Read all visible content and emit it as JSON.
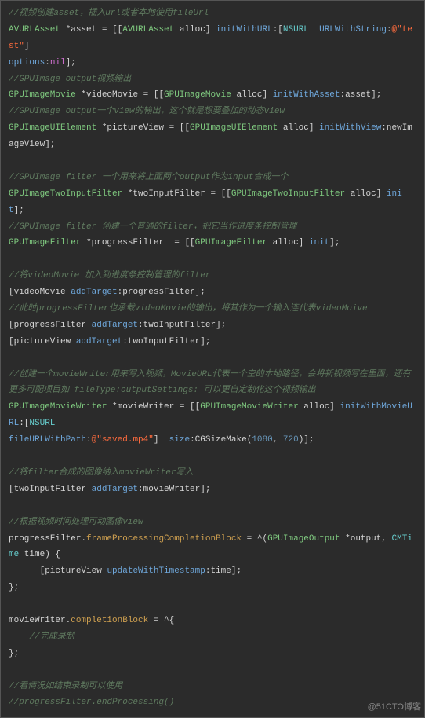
{
  "watermark": "@51CTO博客",
  "lines": {
    "c1": "//视频创建asset，插入url或者本地使用fileUrl",
    "l1a": "AVURLAsset",
    "l1b": " *asset = [[",
    "l1c": "AVURLAsset",
    "l1d": " alloc] ",
    "l1e": "initWithURL",
    "l1f": ":[",
    "l1g": "NSURL",
    "l1h": "  ",
    "l1i": "URLWithString",
    "l1j": ":",
    "l1k": "@\"test\"",
    "l1l": "]",
    "l2a": "options",
    "l2b": ":",
    "l2c": "nil",
    "l2d": "];",
    "c2": "//GPUImage output视频输出",
    "l3a": "GPUImageMovie",
    "l3b": " *videoMovie = [[",
    "l3c": "GPUImageMovie",
    "l3d": " alloc] ",
    "l3e": "initWithAsset",
    "l3f": ":asset];",
    "c3": "//GPUImage output一个view的输出，这个就是想要叠加的动态view",
    "l4a": "GPUImageUIElement",
    "l4b": " *pictureView = [[",
    "l4c": "GPUImageUIElement",
    "l4d": " alloc] ",
    "l4e": "initWithView",
    "l4f": ":newImageView];",
    "c4": "//GPUImage filter 一个用来将上面两个output作为input合成一个",
    "l5a": "GPUImageTwoInputFilter",
    "l5b": " *twoInputFilter = [[",
    "l5c": "GPUImageTwoInputFilter",
    "l5d": " alloc] ",
    "l5e": "init",
    "l5f": "];",
    "c5": "//GPUImage filter 创建一个普通的filter，把它当作进度条控制管理",
    "l6a": "GPUImageFilter",
    "l6b": " *progressFilter  = [[",
    "l6c": "GPUImageFilter",
    "l6d": " alloc] ",
    "l6e": "init",
    "l6f": "];",
    "c6": "//将videoMovie 加入到进度条控制管理的filter",
    "l7a": "[videoMovie ",
    "l7b": "addTarget",
    "l7c": ":progressFilter];",
    "c7": "//此时progressFilter也承载videoMovie的输出，将其作为一个输入连代表videoMoive",
    "l8a": "[progressFilter ",
    "l8b": "addTarget",
    "l8c": ":twoInputFilter];",
    "l9a": "[pictureView ",
    "l9b": "addTarget",
    "l9c": ":twoInputFilter];",
    "c8": "//创建一个movieWriter用来写入视频，MovieURL代表一个空的本地路径，会将新视频写在里面，还有更多可配项目如 fileType:outputSettings: 可以更自定制化这个视频输出",
    "l10a": "GPUImageMovieWriter",
    "l10b": " *movieWriter = [[",
    "l10c": "GPUImageMovieWriter",
    "l10d": " alloc] ",
    "l10e": "initWithMovieURL",
    "l10f": ":[",
    "l10g": "NSURL",
    "l10h": " ",
    "l11a": "fileURLWithPath",
    "l11b": ":",
    "l11c": "@\"saved.mp4\"",
    "l11d": "]  ",
    "l11e": "size",
    "l11f": ":CGSizeMake(",
    "l11g": "1080",
    "l11h": ", ",
    "l11i": "720",
    "l11j": ")];",
    "c9": "//将filter合成的图像纳入movieWriter写入",
    "l12a": "[twoInputFilter ",
    "l12b": "addTarget",
    "l12c": ":movieWriter];",
    "c10": "//根据视频时间处理可动图像view",
    "l13a": "progressFilter.",
    "l13b": "frameProcessingCompletionBlock",
    "l13c": " = ^(",
    "l13d": "GPUImageOutput",
    "l13e": " *output, ",
    "l13f": "CMTime",
    "l13g": " time) {",
    "l14a": "      [pictureView ",
    "l14b": "updateWithTimestamp",
    "l14c": ":time];",
    "l15": "};",
    "l16a": "movieWriter.",
    "l16b": "completionBlock",
    "l16c": " = ^{",
    "c11": "    //完成录制",
    "l17": "};",
    "c12": "//看情况如结束录制可以使用",
    "c13": "//progressFilter.endProcessing()"
  }
}
